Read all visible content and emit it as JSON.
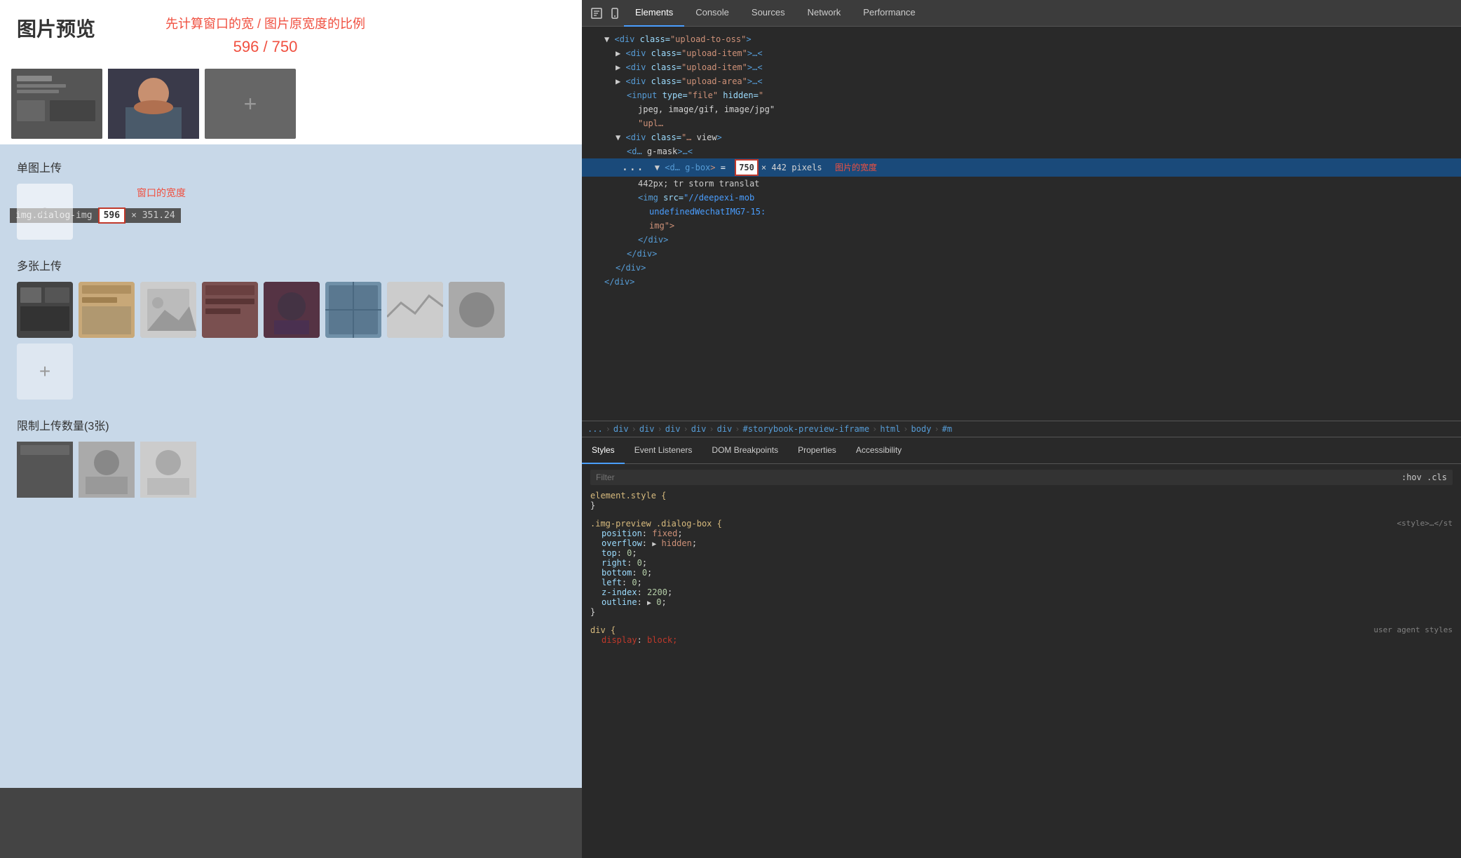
{
  "left": {
    "title": "图片预览",
    "info_text": "先计算窗口的宽 / 图片原宽度的比例",
    "ratio": "596 / 750",
    "window_width_label": "窗口的宽度",
    "selector_label": "img.dialog-img",
    "selector_width": "596",
    "selector_rest": "× 351.24",
    "sections": [
      {
        "title": "单图上传"
      },
      {
        "title": "多张上传"
      },
      {
        "title": "限制上传数量(3张)"
      }
    ],
    "add_icon": "+",
    "bottom_bar_text": ""
  },
  "devtools": {
    "tabs": [
      {
        "label": "Elements",
        "active": true
      },
      {
        "label": "Console",
        "active": false
      },
      {
        "label": "Sources",
        "active": false
      },
      {
        "label": "Network",
        "active": false
      },
      {
        "label": "Performance",
        "active": false
      }
    ],
    "dom_lines": [
      {
        "indent": 2,
        "content": "▼ <div class=\"upload-to-oss\">"
      },
      {
        "indent": 3,
        "content": "▶ <div class=\"upload-item\">…<"
      },
      {
        "indent": 3,
        "content": "▶ <div class=\"upload-item\">…<"
      },
      {
        "indent": 3,
        "content": "▶ <div class=\"upload-area\">…<"
      },
      {
        "indent": 4,
        "content": "<input type=\"file\" hidden=\""
      },
      {
        "indent": 5,
        "content": "jpeg, image/gif, image/jpg\""
      },
      {
        "indent": 5,
        "content": "\"upl…"
      },
      {
        "indent": 3,
        "content": "▼ <div class=\"…"
      },
      {
        "indent": 4,
        "content": "<d…             …g-mask\">…<"
      },
      {
        "indent": 3,
        "selected": true,
        "content": "▼ <d…               …g-box\"> ="
      }
    ],
    "dim_tooltip": {
      "value": "750",
      "text": "× 442 pixels",
      "label_cn": "图片的宽度",
      "suffix": "442px; tr  storm  translat"
    },
    "dom_lines_2": [
      {
        "indent": 5,
        "content": "<img src=\"//deepexi-mob"
      },
      {
        "indent": 6,
        "content": "undefinedWechatIMG7-15:"
      },
      {
        "indent": 6,
        "content": "img\">"
      },
      {
        "indent": 5,
        "content": "</div>"
      },
      {
        "indent": 4,
        "content": "</div>"
      },
      {
        "indent": 3,
        "content": "</div>"
      },
      {
        "indent": 2,
        "content": "</div>"
      }
    ],
    "breadcrumb": [
      "...",
      "div",
      "div",
      "div",
      "div",
      "div",
      "#storybook-preview-iframe",
      "html",
      "body",
      "#m"
    ],
    "bottom_tabs": [
      "Styles",
      "Event Listeners",
      "DOM Breakpoints",
      "Properties",
      "Accessibility"
    ],
    "styles": {
      "filter_placeholder": "Filter",
      "filter_right": ":hov .cls",
      "rules": [
        {
          "selector": "element.style {",
          "close": "}",
          "props": []
        },
        {
          "selector": ".img-preview .dialog-box {",
          "source": "<style>…</st",
          "props": [
            {
              "name": "position",
              "value": "fixed;"
            },
            {
              "name": "overflow",
              "value": "▶ hidden;",
              "has_triangle": true
            },
            {
              "name": "top",
              "value": "0;"
            },
            {
              "name": "right",
              "value": "0;"
            },
            {
              "name": "bottom",
              "value": "0;"
            },
            {
              "name": "left",
              "value": "0;"
            },
            {
              "name": "z-index",
              "value": "2200;"
            },
            {
              "name": "outline",
              "value": "▶ 0;",
              "has_triangle": true
            }
          ],
          "close": "}"
        },
        {
          "selector": "div {",
          "source": "user agent styles",
          "props": [
            {
              "name": "display",
              "value": "block;"
            }
          ]
        }
      ]
    }
  }
}
